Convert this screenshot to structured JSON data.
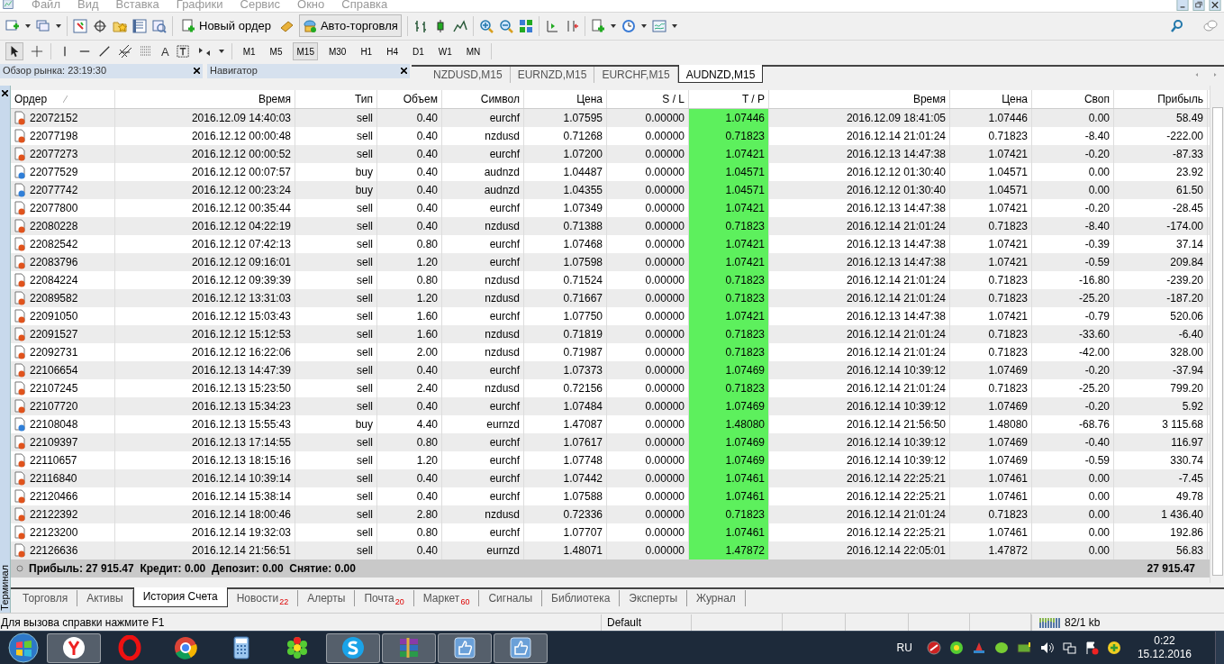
{
  "menu": [
    "Файл",
    "Вид",
    "Вставка",
    "Графики",
    "Сервис",
    "Окно",
    "Справка"
  ],
  "toolbar": {
    "new_order": "Новый ордер",
    "auto_trading": "Авто-торговля",
    "text_tool": "A"
  },
  "timeframes": [
    {
      "label": "M1",
      "selected": false
    },
    {
      "label": "M5",
      "selected": false
    },
    {
      "label": "M15",
      "selected": true
    },
    {
      "label": "M30",
      "selected": false
    },
    {
      "label": "H1",
      "selected": false
    },
    {
      "label": "H4",
      "selected": false
    },
    {
      "label": "D1",
      "selected": false
    },
    {
      "label": "W1",
      "selected": false
    },
    {
      "label": "MN",
      "selected": false
    }
  ],
  "panels": [
    {
      "title": "Обзор рынка: 23:19:30"
    },
    {
      "title": "Навигатор"
    }
  ],
  "chart_tabs": [
    {
      "label": "NZDUSD,M15",
      "selected": false
    },
    {
      "label": "EURNZD,M15",
      "selected": false
    },
    {
      "label": "EURCHF,M15",
      "selected": false
    },
    {
      "label": "AUDNZD,M15",
      "selected": true
    }
  ],
  "table": {
    "columns": [
      "Ордер",
      "Время",
      "Тип",
      "Объем",
      "Символ",
      "Цена",
      "S / L",
      "T / P",
      "Время",
      "Цена",
      "Своп",
      "Прибыль"
    ],
    "rows": [
      {
        "kind": "sell",
        "cells": [
          "22072152",
          "2016.12.09 14:40:03",
          "sell",
          "0.40",
          "eurchf",
          "1.07595",
          "0.00000",
          "1.07446",
          "2016.12.09 18:41:05",
          "1.07446",
          "0.00",
          "58.49"
        ]
      },
      {
        "kind": "sell",
        "cells": [
          "22077198",
          "2016.12.12 00:00:48",
          "sell",
          "0.40",
          "nzdusd",
          "0.71268",
          "0.00000",
          "0.71823",
          "2016.12.14 21:01:24",
          "0.71823",
          "-8.40",
          "-222.00"
        ]
      },
      {
        "kind": "sell",
        "cells": [
          "22077273",
          "2016.12.12 00:00:52",
          "sell",
          "0.40",
          "eurchf",
          "1.07200",
          "0.00000",
          "1.07421",
          "2016.12.13 14:47:38",
          "1.07421",
          "-0.20",
          "-87.33"
        ]
      },
      {
        "kind": "buy",
        "cells": [
          "22077529",
          "2016.12.12 00:07:57",
          "buy",
          "0.40",
          "audnzd",
          "1.04487",
          "0.00000",
          "1.04571",
          "2016.12.12 01:30:40",
          "1.04571",
          "0.00",
          "23.92"
        ]
      },
      {
        "kind": "buy",
        "cells": [
          "22077742",
          "2016.12.12 00:23:24",
          "buy",
          "0.40",
          "audnzd",
          "1.04355",
          "0.00000",
          "1.04571",
          "2016.12.12 01:30:40",
          "1.04571",
          "0.00",
          "61.50"
        ]
      },
      {
        "kind": "sell",
        "cells": [
          "22077800",
          "2016.12.12 00:35:44",
          "sell",
          "0.40",
          "eurchf",
          "1.07349",
          "0.00000",
          "1.07421",
          "2016.12.13 14:47:38",
          "1.07421",
          "-0.20",
          "-28.45"
        ]
      },
      {
        "kind": "sell",
        "cells": [
          "22080228",
          "2016.12.12 04:22:19",
          "sell",
          "0.40",
          "nzdusd",
          "0.71388",
          "0.00000",
          "0.71823",
          "2016.12.14 21:01:24",
          "0.71823",
          "-8.40",
          "-174.00"
        ]
      },
      {
        "kind": "sell",
        "cells": [
          "22082542",
          "2016.12.12 07:42:13",
          "sell",
          "0.80",
          "eurchf",
          "1.07468",
          "0.00000",
          "1.07421",
          "2016.12.13 14:47:38",
          "1.07421",
          "-0.39",
          "37.14"
        ]
      },
      {
        "kind": "sell",
        "cells": [
          "22083796",
          "2016.12.12 09:16:01",
          "sell",
          "1.20",
          "eurchf",
          "1.07598",
          "0.00000",
          "1.07421",
          "2016.12.13 14:47:38",
          "1.07421",
          "-0.59",
          "209.84"
        ]
      },
      {
        "kind": "sell",
        "cells": [
          "22084224",
          "2016.12.12 09:39:39",
          "sell",
          "0.80",
          "nzdusd",
          "0.71524",
          "0.00000",
          "0.71823",
          "2016.12.14 21:01:24",
          "0.71823",
          "-16.80",
          "-239.20"
        ]
      },
      {
        "kind": "sell",
        "cells": [
          "22089582",
          "2016.12.12 13:31:03",
          "sell",
          "1.20",
          "nzdusd",
          "0.71667",
          "0.00000",
          "0.71823",
          "2016.12.14 21:01:24",
          "0.71823",
          "-25.20",
          "-187.20"
        ]
      },
      {
        "kind": "sell",
        "cells": [
          "22091050",
          "2016.12.12 15:03:43",
          "sell",
          "1.60",
          "eurchf",
          "1.07750",
          "0.00000",
          "1.07421",
          "2016.12.13 14:47:38",
          "1.07421",
          "-0.79",
          "520.06"
        ]
      },
      {
        "kind": "sell",
        "cells": [
          "22091527",
          "2016.12.12 15:12:53",
          "sell",
          "1.60",
          "nzdusd",
          "0.71819",
          "0.00000",
          "0.71823",
          "2016.12.14 21:01:24",
          "0.71823",
          "-33.60",
          "-6.40"
        ]
      },
      {
        "kind": "sell",
        "cells": [
          "22092731",
          "2016.12.12 16:22:06",
          "sell",
          "2.00",
          "nzdusd",
          "0.71987",
          "0.00000",
          "0.71823",
          "2016.12.14 21:01:24",
          "0.71823",
          "-42.00",
          "328.00"
        ]
      },
      {
        "kind": "sell",
        "cells": [
          "22106654",
          "2016.12.13 14:47:39",
          "sell",
          "0.40",
          "eurchf",
          "1.07373",
          "0.00000",
          "1.07469",
          "2016.12.14 10:39:12",
          "1.07469",
          "-0.20",
          "-37.94"
        ]
      },
      {
        "kind": "sell",
        "cells": [
          "22107245",
          "2016.12.13 15:23:50",
          "sell",
          "2.40",
          "nzdusd",
          "0.72156",
          "0.00000",
          "0.71823",
          "2016.12.14 21:01:24",
          "0.71823",
          "-25.20",
          "799.20"
        ]
      },
      {
        "kind": "sell",
        "cells": [
          "22107720",
          "2016.12.13 15:34:23",
          "sell",
          "0.40",
          "eurchf",
          "1.07484",
          "0.00000",
          "1.07469",
          "2016.12.14 10:39:12",
          "1.07469",
          "-0.20",
          "5.92"
        ]
      },
      {
        "kind": "buy",
        "cells": [
          "22108048",
          "2016.12.13 15:55:43",
          "buy",
          "4.40",
          "eurnzd",
          "1.47087",
          "0.00000",
          "1.48080",
          "2016.12.14 21:56:50",
          "1.48080",
          "-68.76",
          "3 115.68"
        ]
      },
      {
        "kind": "sell",
        "cells": [
          "22109397",
          "2016.12.13 17:14:55",
          "sell",
          "0.80",
          "eurchf",
          "1.07617",
          "0.00000",
          "1.07469",
          "2016.12.14 10:39:12",
          "1.07469",
          "-0.40",
          "116.97"
        ]
      },
      {
        "kind": "sell",
        "cells": [
          "22110657",
          "2016.12.13 18:15:16",
          "sell",
          "1.20",
          "eurchf",
          "1.07748",
          "0.00000",
          "1.07469",
          "2016.12.14 10:39:12",
          "1.07469",
          "-0.59",
          "330.74"
        ]
      },
      {
        "kind": "sell",
        "cells": [
          "22116840",
          "2016.12.14 10:39:14",
          "sell",
          "0.40",
          "eurchf",
          "1.07442",
          "0.00000",
          "1.07461",
          "2016.12.14 22:25:21",
          "1.07461",
          "0.00",
          "-7.45"
        ]
      },
      {
        "kind": "sell",
        "cells": [
          "22120466",
          "2016.12.14 15:38:14",
          "sell",
          "0.40",
          "eurchf",
          "1.07588",
          "0.00000",
          "1.07461",
          "2016.12.14 22:25:21",
          "1.07461",
          "0.00",
          "49.78"
        ]
      },
      {
        "kind": "sell",
        "cells": [
          "22122392",
          "2016.12.14 18:00:46",
          "sell",
          "2.80",
          "nzdusd",
          "0.72336",
          "0.00000",
          "0.71823",
          "2016.12.14 21:01:24",
          "0.71823",
          "0.00",
          "1 436.40"
        ]
      },
      {
        "kind": "sell",
        "cells": [
          "22123200",
          "2016.12.14 19:32:03",
          "sell",
          "0.80",
          "eurchf",
          "1.07707",
          "0.00000",
          "1.07461",
          "2016.12.14 22:25:21",
          "1.07461",
          "0.00",
          "192.86"
        ]
      },
      {
        "kind": "sell",
        "cells": [
          "22126636",
          "2016.12.14 21:56:51",
          "sell",
          "0.40",
          "eurnzd",
          "1.48071",
          "0.00000",
          "1.47872",
          "2016.12.14 22:05:01",
          "1.47872",
          "0.00",
          "56.83"
        ]
      }
    ],
    "summary": "Прибыль: 27 915.47  Кредит: 0.00  Депозит: 0.00  Снятие: 0.00",
    "summary_total": "27 915.47"
  },
  "terminal_label": "Терминал",
  "terminal_tabs": [
    {
      "label": "Торговля",
      "selected": false
    },
    {
      "label": "Активы",
      "selected": false
    },
    {
      "label": "История Счета",
      "selected": true
    },
    {
      "label": "Новости",
      "badge": "22",
      "selected": false
    },
    {
      "label": "Алерты",
      "selected": false
    },
    {
      "label": "Почта",
      "badge": "20",
      "selected": false
    },
    {
      "label": "Маркет",
      "badge": "60",
      "selected": false
    },
    {
      "label": "Сигналы",
      "selected": false
    },
    {
      "label": "Библиотека",
      "selected": false
    },
    {
      "label": "Эксперты",
      "selected": false
    },
    {
      "label": "Журнал",
      "selected": false
    }
  ],
  "status_bar": {
    "help": "Для вызова справки нажмите F1",
    "profile": "Default",
    "traffic": "82/1 kb"
  },
  "taskbar": {
    "language": "RU",
    "time": "0:22",
    "date": "15.12.2016"
  }
}
